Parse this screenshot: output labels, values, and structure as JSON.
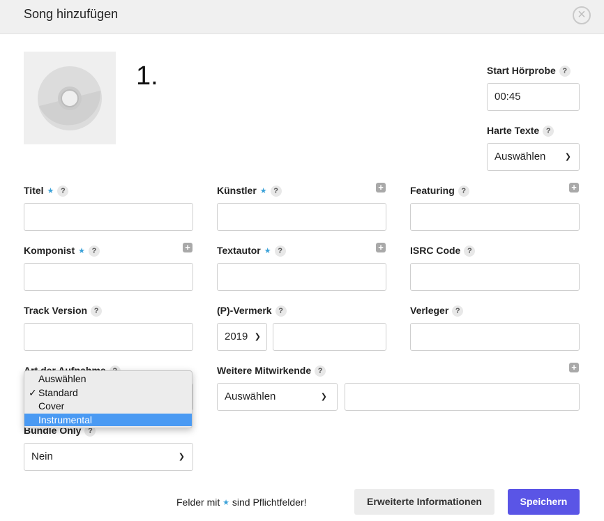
{
  "dialog": {
    "title": "Song hinzufügen",
    "close_icon": "close-icon"
  },
  "track": {
    "number": "1."
  },
  "start_preview": {
    "label": "Start Hörprobe",
    "value": "00:45"
  },
  "harte_texte": {
    "label": "Harte Texte",
    "value": "Auswählen"
  },
  "fields": {
    "titel": {
      "label": "Titel",
      "value": ""
    },
    "kuenstler": {
      "label": "Künstler",
      "value": ""
    },
    "featuring": {
      "label": "Featuring",
      "value": ""
    },
    "komponist": {
      "label": "Komponist",
      "value": ""
    },
    "textautor": {
      "label": "Textautor",
      "value": ""
    },
    "isrc": {
      "label": "ISRC Code",
      "value": ""
    },
    "track_version": {
      "label": "Track Version",
      "value": ""
    },
    "p_vermerk": {
      "label": "(P)-Vermerk",
      "year": "2019",
      "value": ""
    },
    "verleger": {
      "label": "Verleger",
      "value": ""
    },
    "art_der_aufnahme": {
      "label": "Art der Aufnahme"
    },
    "weitere_mitwirkende": {
      "label": "Weitere Mitwirkende",
      "select_value": "Auswählen",
      "value": ""
    },
    "bundle_only": {
      "label": "Bundle Only",
      "value": "Nein"
    }
  },
  "recording_type_dropdown": {
    "options": [
      "Auswählen",
      "Standard",
      "Cover",
      "Instrumental"
    ],
    "checked": "Standard",
    "highlighted": "Instrumental"
  },
  "footer": {
    "note_prefix": "Felder mit",
    "note_suffix": "sind Pflichtfelder!",
    "secondary_button": "Erweiterte Informationen",
    "primary_button": "Speichern"
  },
  "colors": {
    "accent": "#5a55e6",
    "required_star": "#3aa1d8",
    "highlight": "#4a9af3"
  }
}
